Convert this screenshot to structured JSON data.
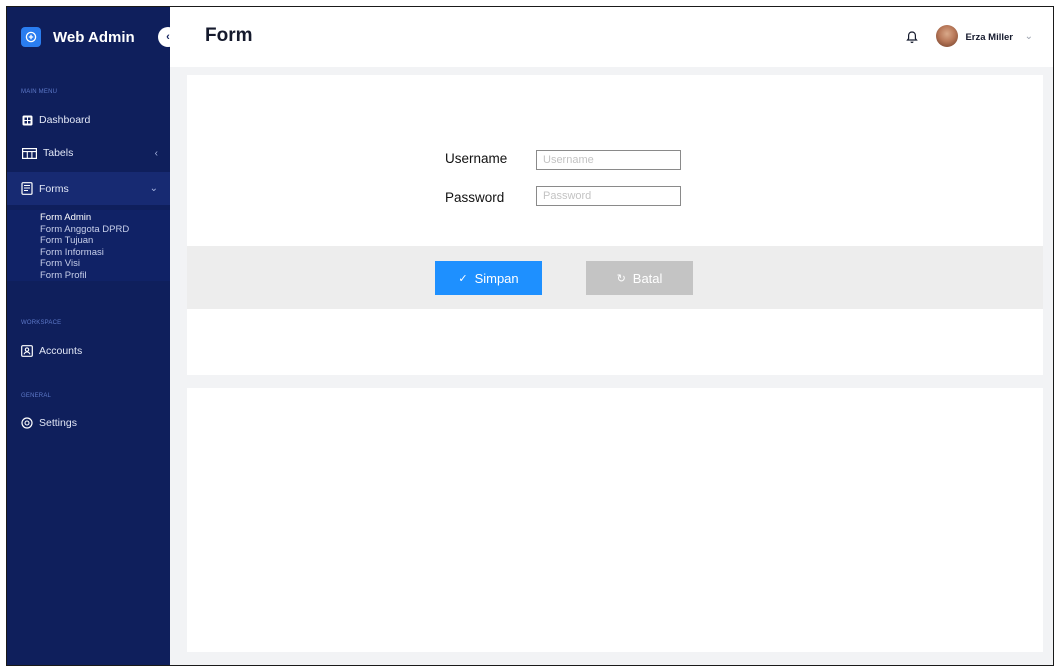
{
  "brand": {
    "title": "Web Admin",
    "collapse_icon": "‹"
  },
  "sidebar": {
    "main_menu_label": "MAIN MENU",
    "dashboard_label": "Dashboard",
    "tables_label": "Tabels",
    "forms_label": "Forms",
    "forms_submenu": [
      "Form Admin",
      "Form Anggota DPRD",
      "Form Tujuan",
      "Form Informasi",
      "Form Visi",
      "Form Profil"
    ],
    "workspace_label": "Workspace",
    "accounts_label": "Accounts",
    "general_label": "General",
    "settings_label": "Settings"
  },
  "header": {
    "title": "Form",
    "user_name": "Erza Miller",
    "user_chevron": "⌄"
  },
  "form": {
    "username_label": "Username",
    "username_placeholder": "Username",
    "username_value": "",
    "password_label": "Password",
    "password_placeholder": "Password",
    "password_value": "",
    "save_label": "Simpan",
    "save_icon": "✓",
    "cancel_label": "Batal",
    "cancel_icon": "↻"
  },
  "colors": {
    "sidebar_bg": "#0f1f5c",
    "accent": "#1e90ff",
    "cancel_bg": "#c4c4c4",
    "page_bg": "#f2f3f5"
  },
  "icons": {
    "brand": "plus-circle-icon",
    "dashboard": "grid-icon",
    "tables": "table-icon",
    "forms": "document-icon",
    "accounts": "user-card-icon",
    "settings": "gear-icon",
    "bell": "bell-icon"
  }
}
